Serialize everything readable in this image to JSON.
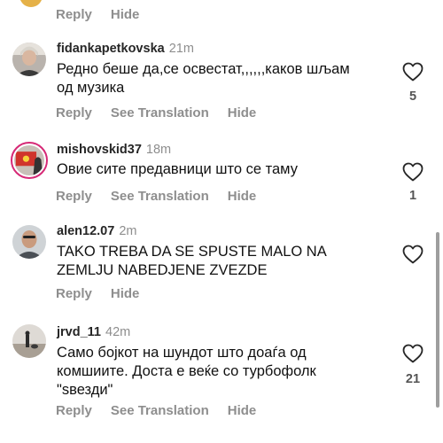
{
  "top_partial": {
    "reply_label": "Reply",
    "hide_label": "Hide"
  },
  "comments": [
    {
      "username": "fidankapetkovska",
      "time": "21m",
      "text": "Редно беше да,се освестат,,,,,,каков шљам од музика",
      "likes": "5",
      "actions": {
        "reply": "Reply",
        "translate": "See Translation",
        "hide": "Hide"
      }
    },
    {
      "username": "mishovskid37",
      "time": "18m",
      "text": "Овие сите предавници што се таму",
      "likes": "1",
      "actions": {
        "reply": "Reply",
        "translate": "See Translation",
        "hide": "Hide"
      }
    },
    {
      "username": "alen12.07",
      "time": "2m",
      "text": "TAKO TREBA DA SE SPUSTE MALO NA ZEMLJU NABEDJENE ZVEZDE",
      "likes": "",
      "actions": {
        "reply": "Reply",
        "hide": "Hide"
      }
    },
    {
      "username": "jrvd_11",
      "time": "42m",
      "text": "Само бојкот на шундот што доаѓа од комшиите. Доста е веќе со турбофолк \"ѕвезди\"",
      "likes": "21",
      "actions": {
        "reply": "Reply",
        "translate": "See Translation",
        "hide": "Hide"
      }
    }
  ],
  "colors": {
    "meta_gray": "#8e8e8e",
    "story_ring": "#d62976"
  },
  "icons": {
    "like": "heart-outline-icon"
  }
}
